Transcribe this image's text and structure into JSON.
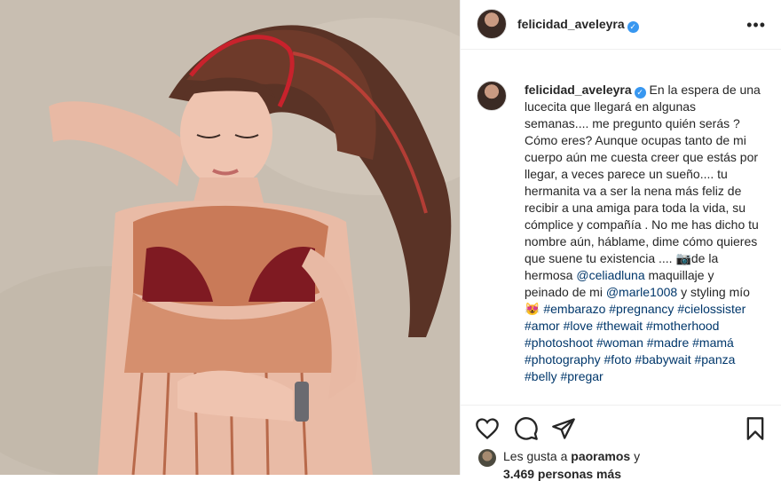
{
  "post": {
    "username": "felicidad_aveleyra",
    "verified_icon": "verified-badge-icon",
    "more_icon": "more-options-icon"
  },
  "caption": {
    "text_1": "En la espera de una lucecita que llegará en algunas semanas.... me pregunto quién serás ? Cómo eres? Aunque ocupas tanto de mi cuerpo aún me cuesta creer que estás por llegar, a veces parece un sueño.... tu hermanita va a ser la nena más feliz de recibir a una amiga para toda la vida, su cómplice y compañía . No me has dicho tu nombre aún, háblame, dime cómo quieres que suene tu existencia .... 📷de la hermosa ",
    "mention_1": "@celiadluna",
    "text_2": " maquillaje y peinado de mi ",
    "mention_2": "@marle1008",
    "text_3": " y styling mío 😻 ",
    "hashtags": "#embarazo #pregnancy #cielossister #amor #love #thewait #motherhood #photoshoot #woman #madre #mamá #photography #foto #babywait #panza #belly #pregar"
  },
  "likes": {
    "prefix": "Les gusta a ",
    "user": "paoramos",
    "suffix": " y",
    "others": "3.469 personas más"
  },
  "colors": {
    "link": "#00376b",
    "verified": "#3897f0",
    "border": "#efefef"
  }
}
